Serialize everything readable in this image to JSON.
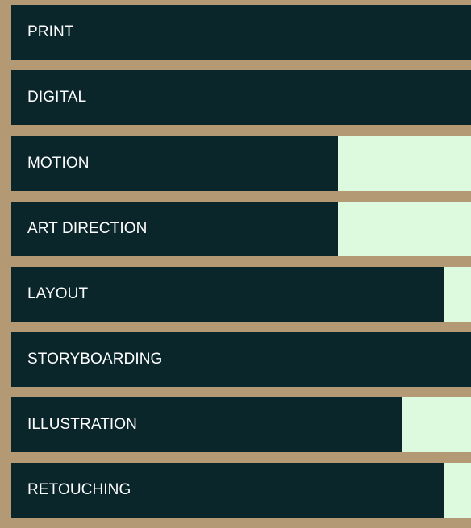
{
  "colors": {
    "frame": "#b49a74",
    "bar_fill": "#0b262b",
    "bar_track": "#ddfadf",
    "label": "#ffffff"
  },
  "skills": [
    {
      "label": "PRINT",
      "level": 1.0
    },
    {
      "label": "DIGITAL",
      "level": 1.0
    },
    {
      "label": "MOTION",
      "level": 0.71
    },
    {
      "label": "ART DIRECTION",
      "level": 0.71
    },
    {
      "label": "LAYOUT",
      "level": 0.94
    },
    {
      "label": "STORYBOARDING",
      "level": 1.0
    },
    {
      "label": "ILLUSTRATION",
      "level": 0.85
    },
    {
      "label": "RETOUCHING",
      "level": 0.94
    }
  ]
}
